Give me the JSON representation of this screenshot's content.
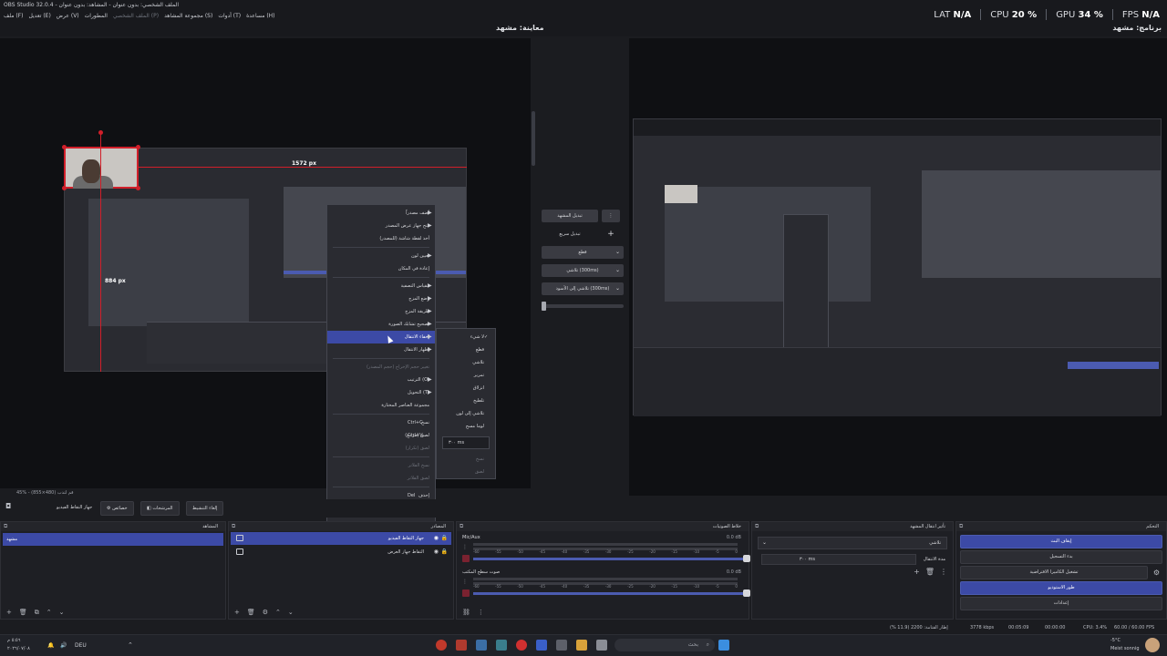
{
  "window": {
    "title": "OBS Studio 32.0.4 - الملف الشخصي: بدون عنوان - المشاهد: بدون عنوان"
  },
  "menubar": [
    {
      "label": "ملف (F)",
      "dim": false
    },
    {
      "label": "تعديل (E)",
      "dim": false
    },
    {
      "label": "عرض (V)",
      "dim": false
    },
    {
      "label": "المطورات",
      "dim": false
    },
    {
      "label": "الملف الشخصي (P)",
      "dim": true
    },
    {
      "label": "مجموعة المشاهد (S)",
      "dim": false
    },
    {
      "label": "أدوات (T)",
      "dim": false
    },
    {
      "label": "مساعدة (H)",
      "dim": false
    }
  ],
  "stats": {
    "fps_label": "FPS",
    "fps_value": "N/A",
    "gpu_label": "GPU",
    "gpu_value": "34 %",
    "cpu_label": "CPU",
    "cpu_value": "20 %",
    "lat_label": "LAT",
    "lat_value": "N/A"
  },
  "preview_label": "معاينة: مشهد",
  "program_label": "برنامج: مشهد",
  "preview_overlay": {
    "width_px": "1572 px",
    "height_px": "884 px"
  },
  "context_menu": {
    "items": [
      {
        "label": "أضف مصدراً",
        "submenu": true
      },
      {
        "label": "فتح جهاز عرض المصدر",
        "submenu": true
      },
      {
        "label": "أخذ لقطة شاشة (للمصدر)"
      },
      {
        "sep": true
      },
      {
        "label": "تعيين لون",
        "submenu": true
      },
      {
        "label": "إعادة في المكان"
      },
      {
        "sep": true
      },
      {
        "label": "مقياس التصفية",
        "submenu": true
      },
      {
        "label": "وضع المزج",
        "submenu": true
      },
      {
        "label": "طريقة المزج",
        "submenu": true
      },
      {
        "label": "تصحيح تشابك الصورة",
        "submenu": true
      },
      {
        "label": "إخفاء الانتقال",
        "submenu": true,
        "active": true
      },
      {
        "label": "إظهار الانتقال",
        "submenu": true
      },
      {
        "sep": true
      },
      {
        "label": "تغيير حجم الإخراج (حجم المصدر)",
        "disabled": true
      },
      {
        "label": "الترتيب (O)",
        "submenu": true
      },
      {
        "label": "التحويل (T)",
        "submenu": true
      },
      {
        "label": "مجموعة العناصر المختارة"
      },
      {
        "sep": true
      },
      {
        "label": "نسخ",
        "shortcut": "Ctrl+C"
      },
      {
        "label": "لصق (مرجع)",
        "shortcut": "Ctrl+V"
      },
      {
        "label": "لصق (تكرار)",
        "disabled": true
      },
      {
        "sep": true
      },
      {
        "label": "نسخ الفلاتر",
        "disabled": true
      },
      {
        "label": "لصق الفلاتر",
        "disabled": true
      },
      {
        "sep": true
      },
      {
        "label": "إحذف",
        "shortcut": "Del"
      },
      {
        "label": "إعادة تسمية",
        "shortcut": "F2"
      },
      {
        "sep": true
      },
      {
        "label": "المرشحات"
      },
      {
        "label": "خصائص"
      }
    ]
  },
  "submenu": {
    "items": [
      {
        "label": "لا شيء",
        "checked": true
      },
      {
        "label": "قطع"
      },
      {
        "label": "تلاشي"
      },
      {
        "label": "تمرير"
      },
      {
        "label": "انزلاق"
      },
      {
        "label": "تلطيخ"
      },
      {
        "label": "تلاشي إلى لون"
      },
      {
        "label": "لوما مسح"
      }
    ],
    "spin_value": "٣٠٠ ms",
    "disabled_items": [
      "نسخ",
      "لصق"
    ]
  },
  "middle_controls": {
    "quick_transition_button": "تبديل المشهد",
    "quick_transitions_label": "تبديل سريع",
    "cut_dropdown": "قطع",
    "fade_dropdown": "تلاشي (300ms)",
    "fade_black_dropdown": "تلاشي إلى الأسود (300ms)"
  },
  "toolbar": {
    "zoom_text": "45% - قم لتدب (480×855)",
    "filters_source_label": "جهاز التقاط الفيديو",
    "properties_button": "خصائص",
    "filters_button": "المرشحات",
    "deactivate_button": "إلغاء التنشيط"
  },
  "scenes_dock": {
    "title": "المشاهد",
    "items": [
      "مشهد"
    ]
  },
  "sources_dock": {
    "title": "المصادر",
    "items": [
      {
        "label": "جهاز التقاط الفيديو",
        "active": true
      },
      {
        "label": "التقاط جهاز العرض",
        "active": false
      }
    ]
  },
  "mixer_dock": {
    "title": "خلاط الصوتيات",
    "channels": [
      {
        "name": "Mic/Aux",
        "db": "0.0 dB"
      },
      {
        "name": "صوت سطح المكتب",
        "db": "0.0 dB"
      }
    ],
    "ticks": [
      "-60",
      "-55",
      "-50",
      "-45",
      "-40",
      "-35",
      "-30",
      "-25",
      "-20",
      "-15",
      "-10",
      "-5",
      "0"
    ]
  },
  "transitions_dock": {
    "title": "تأثير انتقال المشهد",
    "selected": "تلاشي",
    "duration_label": "مدة الانتقال",
    "duration_value": "٣٠٠ ms"
  },
  "controls_dock": {
    "title": "التحكم",
    "buttons": [
      {
        "label": "إيقاف البث",
        "style": "blue"
      },
      {
        "label": "بدء التسجيل",
        "style": "normal"
      },
      {
        "label": "تشغيل الكاميرا الافتراضية",
        "style": "normal",
        "gear": true
      },
      {
        "label": "طور الاستوديو",
        "style": "blue"
      },
      {
        "label": "إعدادات",
        "style": "normal"
      }
    ]
  },
  "statusbar": {
    "dropped": "إطار القتامة: 2200 (11.9 %)",
    "bitrate": "3778 kbps",
    "stream_time": "00:05:09",
    "record_time": "00:00:00",
    "cpu": "CPU: 3.4%",
    "fps": "60.00 / 60.00 FPS"
  },
  "taskbar": {
    "time": "٥:٥٦ م",
    "date": "٢٠٢٦/٠٧/٠٨",
    "lang": "DEU",
    "search_placeholder": "بحث",
    "weather_temp": "-5°C",
    "weather_desc": "Meist sonnig"
  },
  "colors": {
    "accent": "#3c4aa6",
    "selection_red": "#d11f2a",
    "background": "#1b1c20"
  }
}
